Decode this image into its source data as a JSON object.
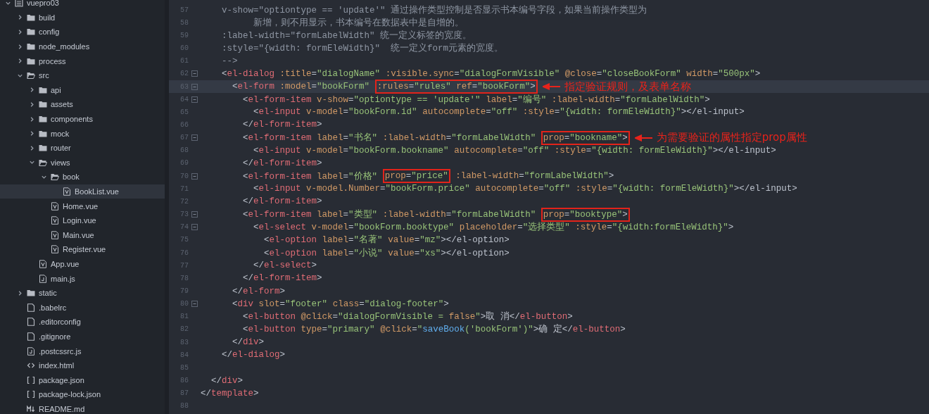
{
  "sidebar": {
    "tree": [
      {
        "name": "vuepro03",
        "kind": "project",
        "expanded": true,
        "selected": false,
        "children": [
          {
            "name": "build",
            "kind": "folder",
            "expanded": false,
            "selected": false
          },
          {
            "name": "config",
            "kind": "folder",
            "expanded": false,
            "selected": false
          },
          {
            "name": "node_modules",
            "kind": "folder",
            "expanded": false,
            "selected": false
          },
          {
            "name": "process",
            "kind": "folder",
            "expanded": false,
            "selected": false
          },
          {
            "name": "src",
            "kind": "folder",
            "expanded": true,
            "selected": false,
            "children": [
              {
                "name": "api",
                "kind": "folder",
                "expanded": false,
                "selected": false
              },
              {
                "name": "assets",
                "kind": "folder",
                "expanded": false,
                "selected": false
              },
              {
                "name": "components",
                "kind": "folder",
                "expanded": false,
                "selected": false
              },
              {
                "name": "mock",
                "kind": "folder",
                "expanded": false,
                "selected": false
              },
              {
                "name": "router",
                "kind": "folder",
                "expanded": false,
                "selected": false
              },
              {
                "name": "views",
                "kind": "folder",
                "expanded": true,
                "selected": false,
                "children": [
                  {
                    "name": "book",
                    "kind": "folder",
                    "expanded": true,
                    "selected": false,
                    "children": [
                      {
                        "name": "BookList.vue",
                        "kind": "vue",
                        "selected": true
                      }
                    ]
                  },
                  {
                    "name": "Home.vue",
                    "kind": "vue",
                    "selected": false
                  },
                  {
                    "name": "Login.vue",
                    "kind": "vue",
                    "selected": false
                  },
                  {
                    "name": "Main.vue",
                    "kind": "vue",
                    "selected": false
                  },
                  {
                    "name": "Register.vue",
                    "kind": "vue",
                    "selected": false
                  }
                ]
              },
              {
                "name": "App.vue",
                "kind": "vue",
                "selected": false
              },
              {
                "name": "main.js",
                "kind": "js",
                "selected": false
              }
            ]
          },
          {
            "name": "static",
            "kind": "folder",
            "expanded": false,
            "selected": false
          },
          {
            "name": ".babelrc",
            "kind": "file",
            "selected": false
          },
          {
            "name": ".editorconfig",
            "kind": "file",
            "selected": false
          },
          {
            "name": ".gitignore",
            "kind": "file",
            "selected": false
          },
          {
            "name": ".postcssrc.js",
            "kind": "js",
            "selected": false
          },
          {
            "name": "index.html",
            "kind": "html",
            "selected": false
          },
          {
            "name": "package.json",
            "kind": "json",
            "selected": false
          },
          {
            "name": "package-lock.json",
            "kind": "json",
            "selected": false
          },
          {
            "name": "README.md",
            "kind": "md",
            "selected": false
          }
        ]
      }
    ]
  },
  "editor": {
    "lines": [
      {
        "num": "57",
        "foldable": false,
        "current": false,
        "comment": true,
        "segments": [
          {
            "text": "    v-show=\"optiontype == 'update'\" 通过操作类型控制是否显示书本编号字段，如果当前操作类型为",
            "boxed": false
          }
        ]
      },
      {
        "num": "58",
        "foldable": false,
        "current": false,
        "comment": true,
        "segments": [
          {
            "text": "          新增，则不用显示，书本编号在数据表中是自增的。",
            "boxed": false
          }
        ]
      },
      {
        "num": "59",
        "foldable": false,
        "current": false,
        "comment": true,
        "segments": [
          {
            "text": "    :label-width=\"formLabelWidth\" 统一定义标签的宽度。",
            "boxed": false
          }
        ]
      },
      {
        "num": "60",
        "foldable": false,
        "current": false,
        "comment": true,
        "segments": [
          {
            "text": "    :style=\"{width: formEleWidth}\"  统一定义form元素的宽度。",
            "boxed": false
          }
        ]
      },
      {
        "num": "61",
        "foldable": false,
        "current": false,
        "comment": true,
        "segments": [
          {
            "text": "    -->",
            "boxed": false
          }
        ]
      },
      {
        "num": "62",
        "foldable": true,
        "current": false,
        "comment": false,
        "segments": [
          {
            "text": "    <el-dialog :title=\"dialogName\" :visible.sync=\"dialogFormVisible\" @close=\"closeBookForm\" width=\"500px\">",
            "boxed": false
          }
        ]
      },
      {
        "num": "63",
        "foldable": true,
        "current": true,
        "comment": false,
        "segments": [
          {
            "text": "      <el-form :model=\"bookForm\" ",
            "boxed": false
          },
          {
            "text": ":rules=\"rules\" ref=\"bookForm\">",
            "boxed": true
          }
        ],
        "annotation": "指定验证规则，及表单名称"
      },
      {
        "num": "64",
        "foldable": true,
        "current": false,
        "comment": false,
        "segments": [
          {
            "text": "        <el-form-item v-show=\"optiontype == 'update'\" label=\"编号\" :label-width=\"formLabelWidth\">",
            "boxed": false
          }
        ]
      },
      {
        "num": "65",
        "foldable": false,
        "current": false,
        "comment": false,
        "segments": [
          {
            "text": "          <el-input v-model=\"bookForm.id\" autocomplete=\"off\" :style=\"{width: formEleWidth}\"></el-input>",
            "boxed": false
          }
        ]
      },
      {
        "num": "66",
        "foldable": false,
        "current": false,
        "comment": false,
        "segments": [
          {
            "text": "        </el-form-item>",
            "boxed": false
          }
        ]
      },
      {
        "num": "67",
        "foldable": true,
        "current": false,
        "comment": false,
        "segments": [
          {
            "text": "        <el-form-item label=\"书名\" :label-width=\"formLabelWidth\" ",
            "boxed": false
          },
          {
            "text": "prop=\"bookname\">",
            "boxed": true
          }
        ],
        "annotation": "为需要验证的属性指定prop属性"
      },
      {
        "num": "68",
        "foldable": false,
        "current": false,
        "comment": false,
        "segments": [
          {
            "text": "          <el-input v-model=\"bookForm.bookname\" autocomplete=\"off\" :style=\"{width: formEleWidth}\"></el-input>",
            "boxed": false
          }
        ]
      },
      {
        "num": "69",
        "foldable": false,
        "current": false,
        "comment": false,
        "segments": [
          {
            "text": "        </el-form-item>",
            "boxed": false
          }
        ]
      },
      {
        "num": "70",
        "foldable": true,
        "current": false,
        "comment": false,
        "segments": [
          {
            "text": "        <el-form-item label=\"价格\" ",
            "boxed": false
          },
          {
            "text": "prop=\"price\"",
            "boxed": true
          },
          {
            "text": " :label-width=\"formLabelWidth\">",
            "boxed": false
          }
        ]
      },
      {
        "num": "71",
        "foldable": false,
        "current": false,
        "comment": false,
        "segments": [
          {
            "text": "          <el-input v-model.Number=\"bookForm.price\" autocomplete=\"off\" :style=\"{width: formEleWidth}\"></el-input>",
            "boxed": false
          }
        ]
      },
      {
        "num": "72",
        "foldable": false,
        "current": false,
        "comment": false,
        "segments": [
          {
            "text": "        </el-form-item>",
            "boxed": false
          }
        ]
      },
      {
        "num": "73",
        "foldable": true,
        "current": false,
        "comment": false,
        "segments": [
          {
            "text": "        <el-form-item label=\"类型\" :label-width=\"formLabelWidth\" ",
            "boxed": false
          },
          {
            "text": "prop=\"booktype\">",
            "boxed": true
          }
        ]
      },
      {
        "num": "74",
        "foldable": true,
        "current": false,
        "comment": false,
        "segments": [
          {
            "text": "          <el-select v-model=\"bookForm.booktype\" placeholder=\"选择类型\" :style=\"{width:formEleWidth}\">",
            "boxed": false
          }
        ]
      },
      {
        "num": "75",
        "foldable": false,
        "current": false,
        "comment": false,
        "segments": [
          {
            "text": "            <el-option label=\"名著\" value=\"mz\"></el-option>",
            "boxed": false
          }
        ]
      },
      {
        "num": "76",
        "foldable": false,
        "current": false,
        "comment": false,
        "segments": [
          {
            "text": "            <el-option label=\"小说\" value=\"xs\"></el-option>",
            "boxed": false
          }
        ]
      },
      {
        "num": "77",
        "foldable": false,
        "current": false,
        "comment": false,
        "segments": [
          {
            "text": "          </el-select>",
            "boxed": false
          }
        ]
      },
      {
        "num": "78",
        "foldable": false,
        "current": false,
        "comment": false,
        "segments": [
          {
            "text": "        </el-form-item>",
            "boxed": false
          }
        ]
      },
      {
        "num": "79",
        "foldable": false,
        "current": false,
        "comment": false,
        "segments": [
          {
            "text": "      </el-form>",
            "boxed": false
          }
        ]
      },
      {
        "num": "80",
        "foldable": true,
        "current": false,
        "comment": false,
        "segments": [
          {
            "text": "      <div slot=\"footer\" class=\"dialog-footer\">",
            "boxed": false
          }
        ]
      },
      {
        "num": "81",
        "foldable": false,
        "current": false,
        "comment": false,
        "segments": [
          {
            "text": "        <el-button @click=\"dialogFormVisible = false\">取 消</el-button>",
            "boxed": false
          }
        ]
      },
      {
        "num": "82",
        "foldable": false,
        "current": false,
        "comment": false,
        "segments": [
          {
            "text": "        <el-button type=\"primary\" @click=\"saveBook('bookForm')\">确 定</el-button>",
            "boxed": false
          }
        ]
      },
      {
        "num": "83",
        "foldable": false,
        "current": false,
        "comment": false,
        "segments": [
          {
            "text": "      </div>",
            "boxed": false
          }
        ]
      },
      {
        "num": "84",
        "foldable": false,
        "current": false,
        "comment": false,
        "segments": [
          {
            "text": "    </el-dialog>",
            "boxed": false
          }
        ]
      },
      {
        "num": "85",
        "foldable": false,
        "current": false
      },
      {
        "num": "86",
        "foldable": false,
        "current": false,
        "comment": false,
        "segments": [
          {
            "text": "  </div>",
            "boxed": false
          }
        ]
      },
      {
        "num": "87",
        "foldable": false,
        "current": false,
        "comment": false,
        "segments": [
          {
            "text": "</template>",
            "boxed": false
          }
        ]
      },
      {
        "num": "88",
        "foldable": false,
        "current": false
      }
    ]
  }
}
